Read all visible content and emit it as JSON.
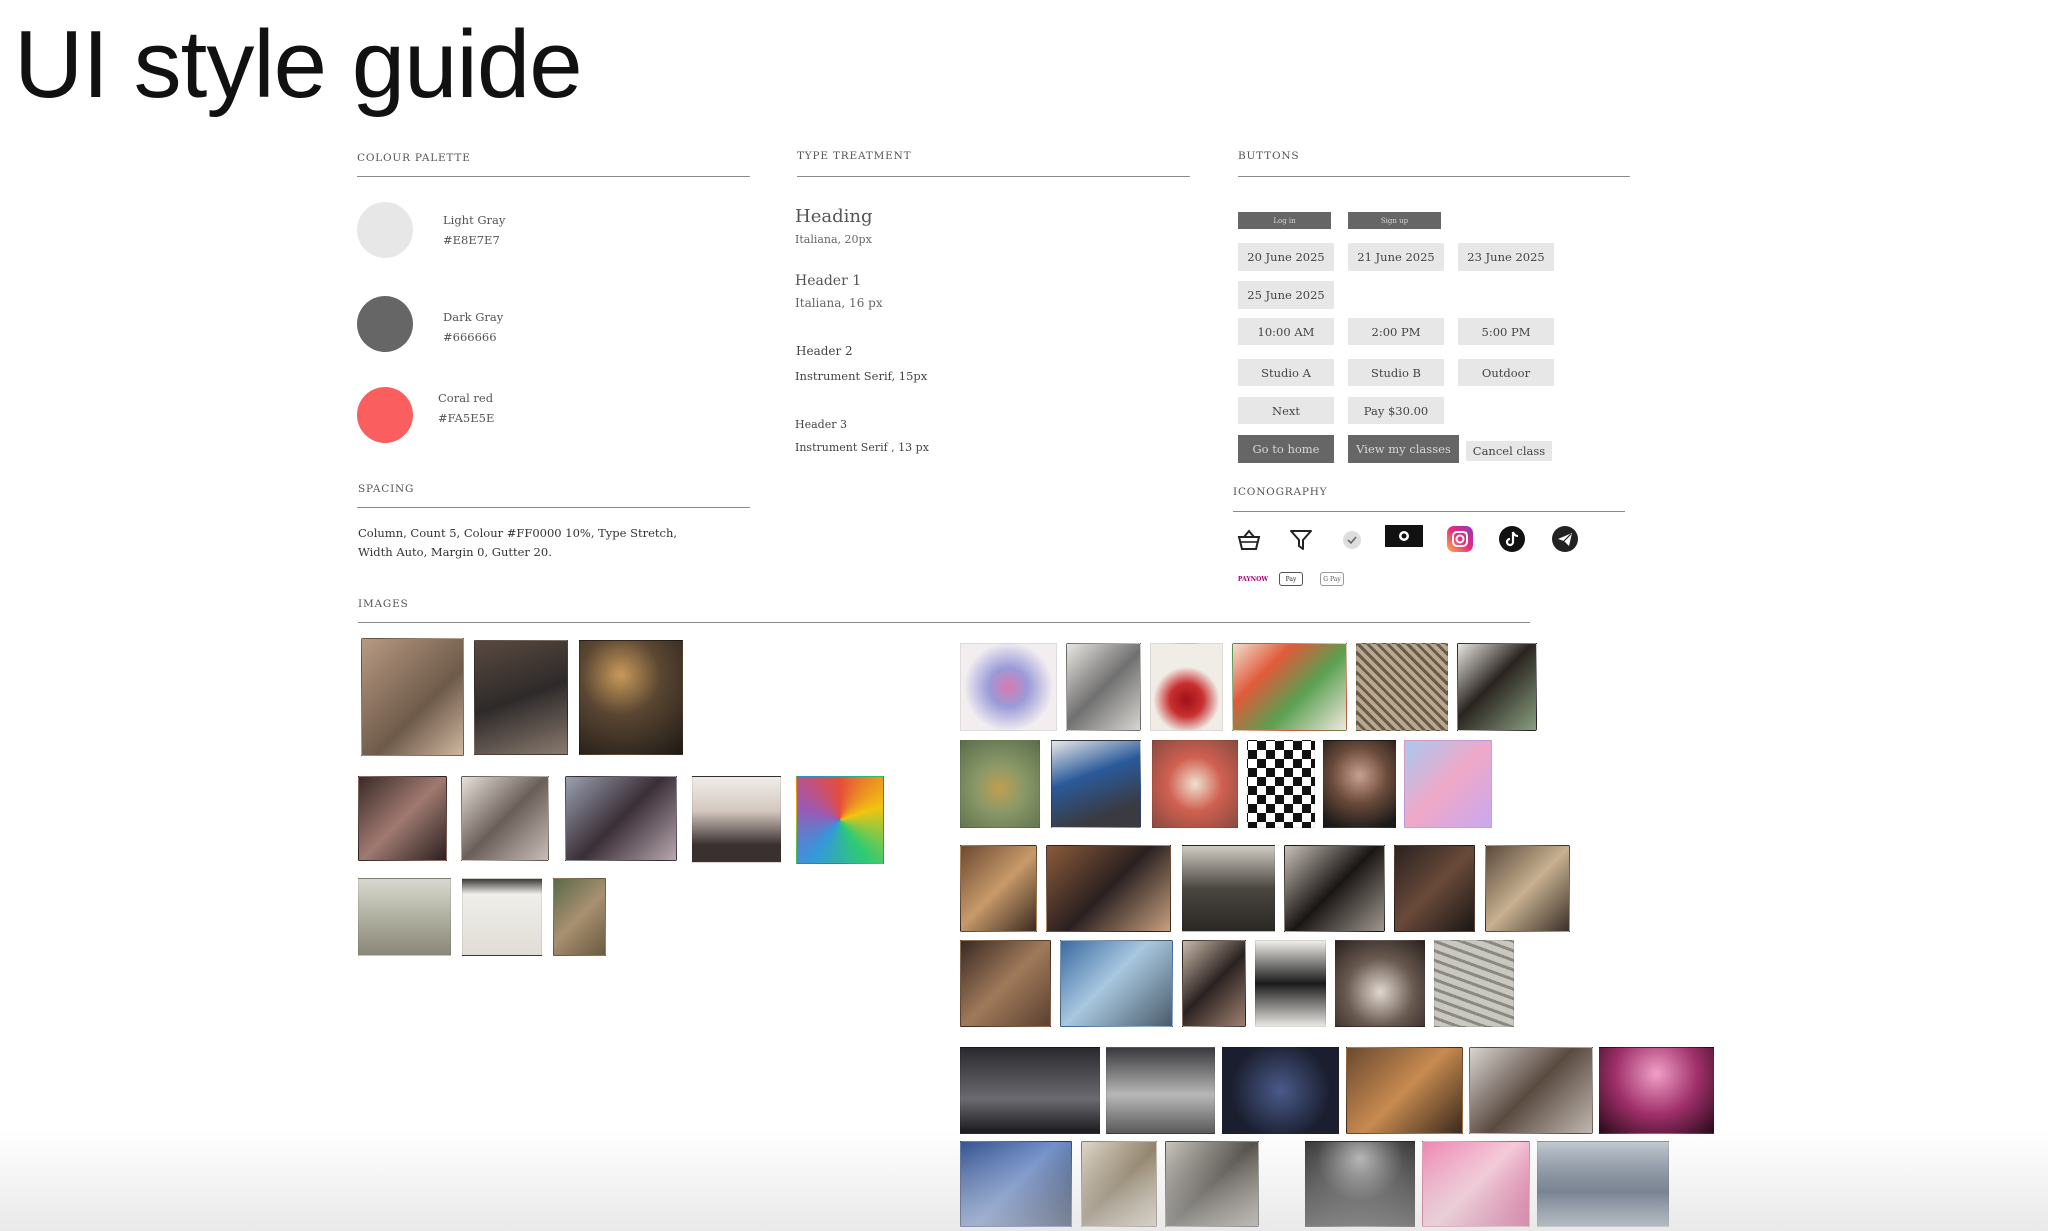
{
  "title": "UI style guide",
  "palette": {
    "label": "COLOUR PALETTE",
    "colors": [
      {
        "name": "Light Gray",
        "hex": "#E8E7E7"
      },
      {
        "name": "Dark Gray",
        "hex": "#666666"
      },
      {
        "name": "Coral red",
        "hex": "#FA5E5E"
      }
    ]
  },
  "spacing": {
    "label": "SPACING",
    "line1": "Column, Count 5, Colour #FF0000 10%, Type Stretch,",
    "line2": "Width Auto, Margin 0, Gutter 20."
  },
  "type": {
    "label": "TYPE TREATMENT",
    "heading": "Heading",
    "heading_spec": "Italiana, 20px",
    "h1": "Header 1",
    "h1_spec": "Italiana, 16 px",
    "h2": "Header 2",
    "h2_spec": "Instrument Serif, 15px",
    "h3": "Header 3",
    "h3_spec": "Instrument  Serif , 13 px"
  },
  "buttons": {
    "label": "BUTTONS",
    "login": "Log in",
    "signup": "Sign up",
    "date1": "20 June 2025",
    "date2": "21 June 2025",
    "date3": "23 June 2025",
    "date4": "25 June 2025",
    "time1": "10:00 AM",
    "time2": "2:00 PM",
    "time3": "5:00 PM",
    "loc1": "Studio A",
    "loc2": "Studio B",
    "loc3": "Outdoor",
    "next": "Next",
    "pay": "Pay $30.00",
    "home": "Go to home",
    "classes": "View my classes",
    "cancel": "Cancel class"
  },
  "iconography": {
    "label": "ICONOGRAPHY",
    "icons": [
      "basket-icon",
      "filter-icon",
      "check-icon",
      "camera-icon",
      "instagram-icon",
      "tiktok-icon",
      "telegram-icon"
    ],
    "payments": {
      "paynow": "PAYNOW",
      "applepay": "Pay",
      "gpay": "G Pay"
    }
  },
  "images": {
    "label": "IMAGES"
  },
  "colors": {
    "light_gray": "#E8E7E7",
    "dark_gray": "#666666",
    "coral": "#FA5E5E"
  }
}
